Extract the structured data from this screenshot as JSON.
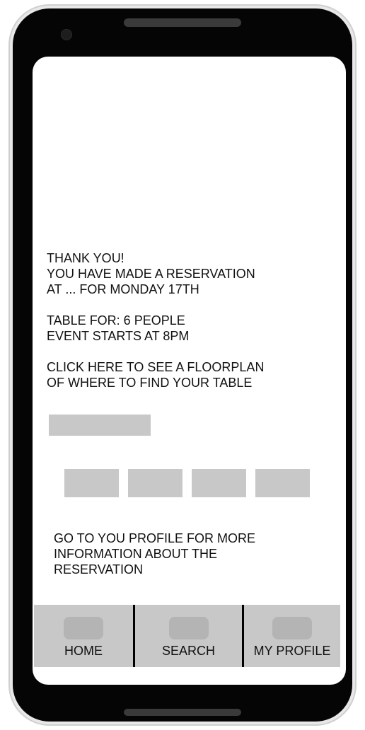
{
  "confirmation": {
    "thank_you": "THANK YOU!\nYOU HAVE MADE A RESERVATION\nAT ... FOR MONDAY 17TH",
    "details": "TABLE FOR: 6 PEOPLE\nEVENT STARTS AT 8PM",
    "floorplan_prompt": "CLICK HERE TO SEE A FLOORPLAN\nOF WHERE TO FIND YOUR TABLE"
  },
  "profile_prompt": "GO TO YOU PROFILE FOR MORE\nINFORMATION ABOUT THE\nRESERVATION",
  "nav": {
    "home": "HOME",
    "search": "SEARCH",
    "profile": "MY PROFILE"
  },
  "icons": {
    "home": "home-icon",
    "search": "search-icon",
    "profile": "profile-icon"
  },
  "colors": {
    "placeholder_gray": "#c8c8c8",
    "icon_gray": "#b4b4b4",
    "nav_divider": "#000000"
  }
}
